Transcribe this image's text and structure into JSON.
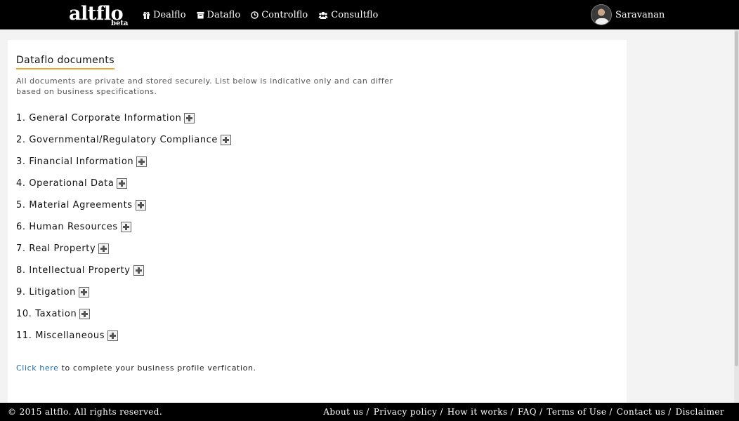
{
  "header": {
    "logo": "altflo",
    "logo_badge": "beta",
    "nav": [
      {
        "label": "Dealflo",
        "icon": "gift-icon"
      },
      {
        "label": "Dataflo",
        "icon": "archive-icon"
      },
      {
        "label": "Controlflo",
        "icon": "clock-icon"
      },
      {
        "label": "Consultflo",
        "icon": "users-icon"
      }
    ],
    "user_name": "Saravanan"
  },
  "main": {
    "title": "Dataflo documents",
    "intro": "All documents are private and stored securely. List below is indicative only and can differ based on business specifications.",
    "documents": [
      "1. General Corporate Information",
      "2. Governmental/Regulatory Compliance",
      "3. Financial Information",
      "4. Operational Data",
      "5. Material Agreements",
      "6. Human Resources",
      "7. Real Property",
      "8. Intellectual Property",
      "9. Litigation",
      "10. Taxation",
      "11. Miscellaneous"
    ],
    "verify_link": "Click here",
    "verify_text": " to complete your business profile verfication."
  },
  "footer": {
    "copyright": "© 2015 altflo. All rights reserved.",
    "links": [
      "About us",
      "Privacy policy",
      "How it works",
      "FAQ",
      "Terms of Use",
      "Contact us",
      "Disclaimer"
    ]
  },
  "colors": {
    "topbar": "#000000",
    "accent_underline": "#f0a32a",
    "link": "#1a6aa8"
  }
}
